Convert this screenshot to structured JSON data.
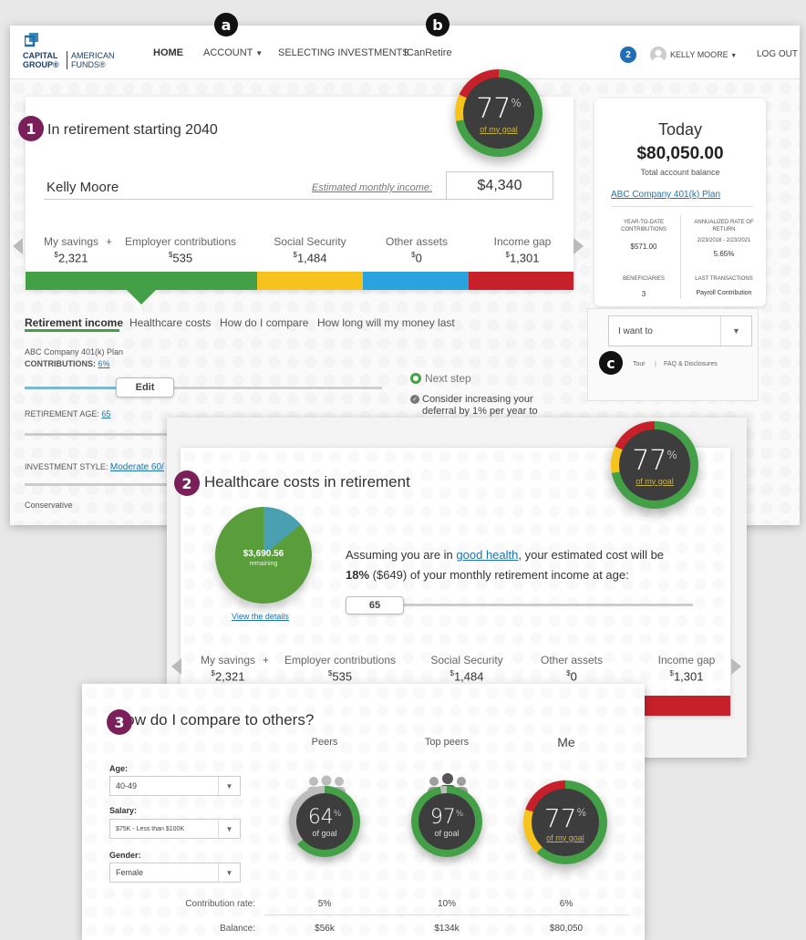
{
  "header": {
    "logo_line1": "CAPITAL",
    "logo_line1b": "AMERICAN",
    "logo_line2": "GROUP®",
    "logo_line2b": "FUNDS®",
    "nav": [
      "HOME",
      "ACCOUNT",
      "SELECTING INVESTMENTS",
      "ICanRetire"
    ],
    "notif_count": "2",
    "user": "KELLY MOORE",
    "logout": "LOG OUT"
  },
  "markers": {
    "a": "a",
    "b": "b",
    "c": "c",
    "one": "1",
    "two": "2",
    "three": "3"
  },
  "panel1": {
    "title": "In retirement starting 2040",
    "name": "Kelly Moore",
    "income_label": "Estimated monthly income:",
    "income_value": "$4,340",
    "gauge_pct": "77",
    "gauge_sub": "of my goal",
    "plus": "+",
    "breakdown": [
      {
        "label": "My savings",
        "value": "2,321"
      },
      {
        "label": "Employer contributions",
        "value": "535"
      },
      {
        "label": "Social Security",
        "value": "1,484"
      },
      {
        "label": "Other assets",
        "value": "0"
      },
      {
        "label": "Income gap",
        "value": "1,301"
      }
    ],
    "tabs": [
      "Retirement income",
      "Healthcare costs",
      "How do I compare",
      "How long will my money last"
    ],
    "plan_name": "ABC Company 401(k) Plan",
    "contributions_label": "CONTRIBUTIONS:",
    "contributions_value": "6%",
    "edit_label": "Edit",
    "next_step": "Next step",
    "next_step_text": "Consider increasing your deferral by 1% per year to",
    "retirement_age_label": "RETIREMENT AGE:",
    "retirement_age_value": "65",
    "investment_style_label": "INVESTMENT STYLE:",
    "investment_style_value": "Moderate 60/",
    "conservative": "Conservative"
  },
  "sidebar": {
    "today": "Today",
    "balance": "$80,050.00",
    "balance_label": "Total account balance",
    "plan_link": "ABC Company 401(k) Plan",
    "ytd_label": "YEAR-TO-DATE CONTRIBUTIONS",
    "ytd_value": "$571.00",
    "ror_label": "ANNUALIZED RATE OF RETURN",
    "ror_dates": "2/23/2018 - 2/23/2021",
    "ror_value": "5.65%",
    "beneficiaries_label": "BENEFICIARIES",
    "beneficiaries_value": "3",
    "last_tx_label": "LAST TRANSACTIONS",
    "last_tx_value": "Payroll Contribution",
    "i_want_to": "I want to",
    "tour": "Tour",
    "sep": "|",
    "faq": "FAQ & Disclosures"
  },
  "panel2": {
    "title": "Healthcare costs in retirement",
    "pie_value": "$3,690.56",
    "pie_sub": "remaining",
    "view_details": "View the details",
    "assume_pre": "Assuming you are in ",
    "assume_link": "good health",
    "assume_post": ", your estimated cost will be",
    "line2_bold": "18%",
    "line2_rest": " ($649) of your monthly retirement income at age:",
    "age_knob": "65",
    "gauge_pct": "77",
    "gauge_sub": "of my goal",
    "plus": "+",
    "breakdown": [
      {
        "label": "My savings",
        "value": "2,321"
      },
      {
        "label": "Employer contributions",
        "value": "535"
      },
      {
        "label": "Social Security",
        "value": "1,484"
      },
      {
        "label": "Other assets",
        "value": "0"
      },
      {
        "label": "Income gap",
        "value": "1,301"
      }
    ]
  },
  "panel3": {
    "title": "How do I compare to others?",
    "cols": [
      "Peers",
      "Top peers",
      "Me"
    ],
    "age_label": "Age:",
    "age_value": "40-49",
    "salary_label": "Salary:",
    "salary_value": "$75K - Less than $100K",
    "gender_label": "Gender:",
    "gender_value": "Female",
    "peers_pct": "64",
    "top_pct": "97",
    "me_pct": "77",
    "of_goal": "of goal",
    "of_my_goal": "of my goal",
    "rows": [
      {
        "label": "Contribution rate:",
        "values": [
          "5%",
          "10%",
          "6%"
        ]
      },
      {
        "label": "Balance:",
        "values": [
          "$56k",
          "$134k",
          "$80,050"
        ]
      }
    ]
  },
  "colors": {
    "green": "#43a047",
    "yellow": "#f6c21c",
    "blue": "#29a3dd",
    "red": "#c8202a",
    "purple": "#7a1f5a"
  }
}
